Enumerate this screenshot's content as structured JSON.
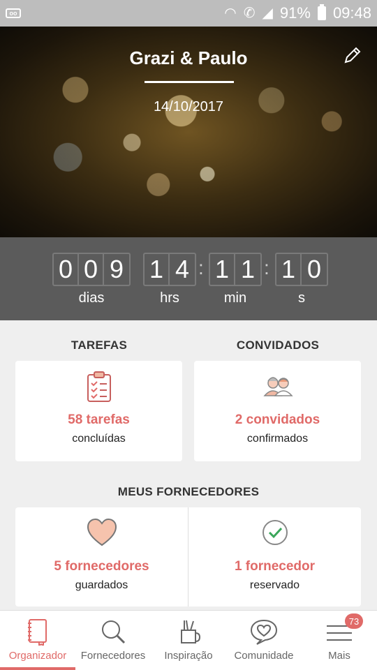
{
  "status_bar": {
    "battery": "91%",
    "time": "09:48"
  },
  "hero": {
    "title": "Grazi & Paulo",
    "date": "14/10/2017"
  },
  "countdown": {
    "days": [
      "0",
      "0",
      "9"
    ],
    "days_label": "dias",
    "hours": [
      "1",
      "4"
    ],
    "hours_label": "hrs",
    "minutes": [
      "1",
      "1"
    ],
    "minutes_label": "min",
    "seconds": [
      "1",
      "0"
    ],
    "seconds_label": "s"
  },
  "tasks": {
    "title": "TAREFAS",
    "value": "58 tarefas",
    "caption": "concluídas"
  },
  "guests": {
    "title": "CONVIDADOS",
    "value": "2 convidados",
    "caption": "confirmados"
  },
  "suppliers": {
    "title": "MEUS FORNECEDORES",
    "saved": {
      "value": "5 fornecedores",
      "caption": "guardados"
    },
    "reserved": {
      "value": "1 fornecedor",
      "caption": "reservado"
    }
  },
  "nav": {
    "items": [
      {
        "label": "Organizador"
      },
      {
        "label": "Fornecedores"
      },
      {
        "label": "Inspiração"
      },
      {
        "label": "Comunidade"
      },
      {
        "label": "Mais",
        "badge": "73"
      }
    ]
  },
  "colors": {
    "accent": "#e06a68",
    "countdown_bg": "#5b5b5b",
    "status_bar": "#bdbdbd"
  }
}
